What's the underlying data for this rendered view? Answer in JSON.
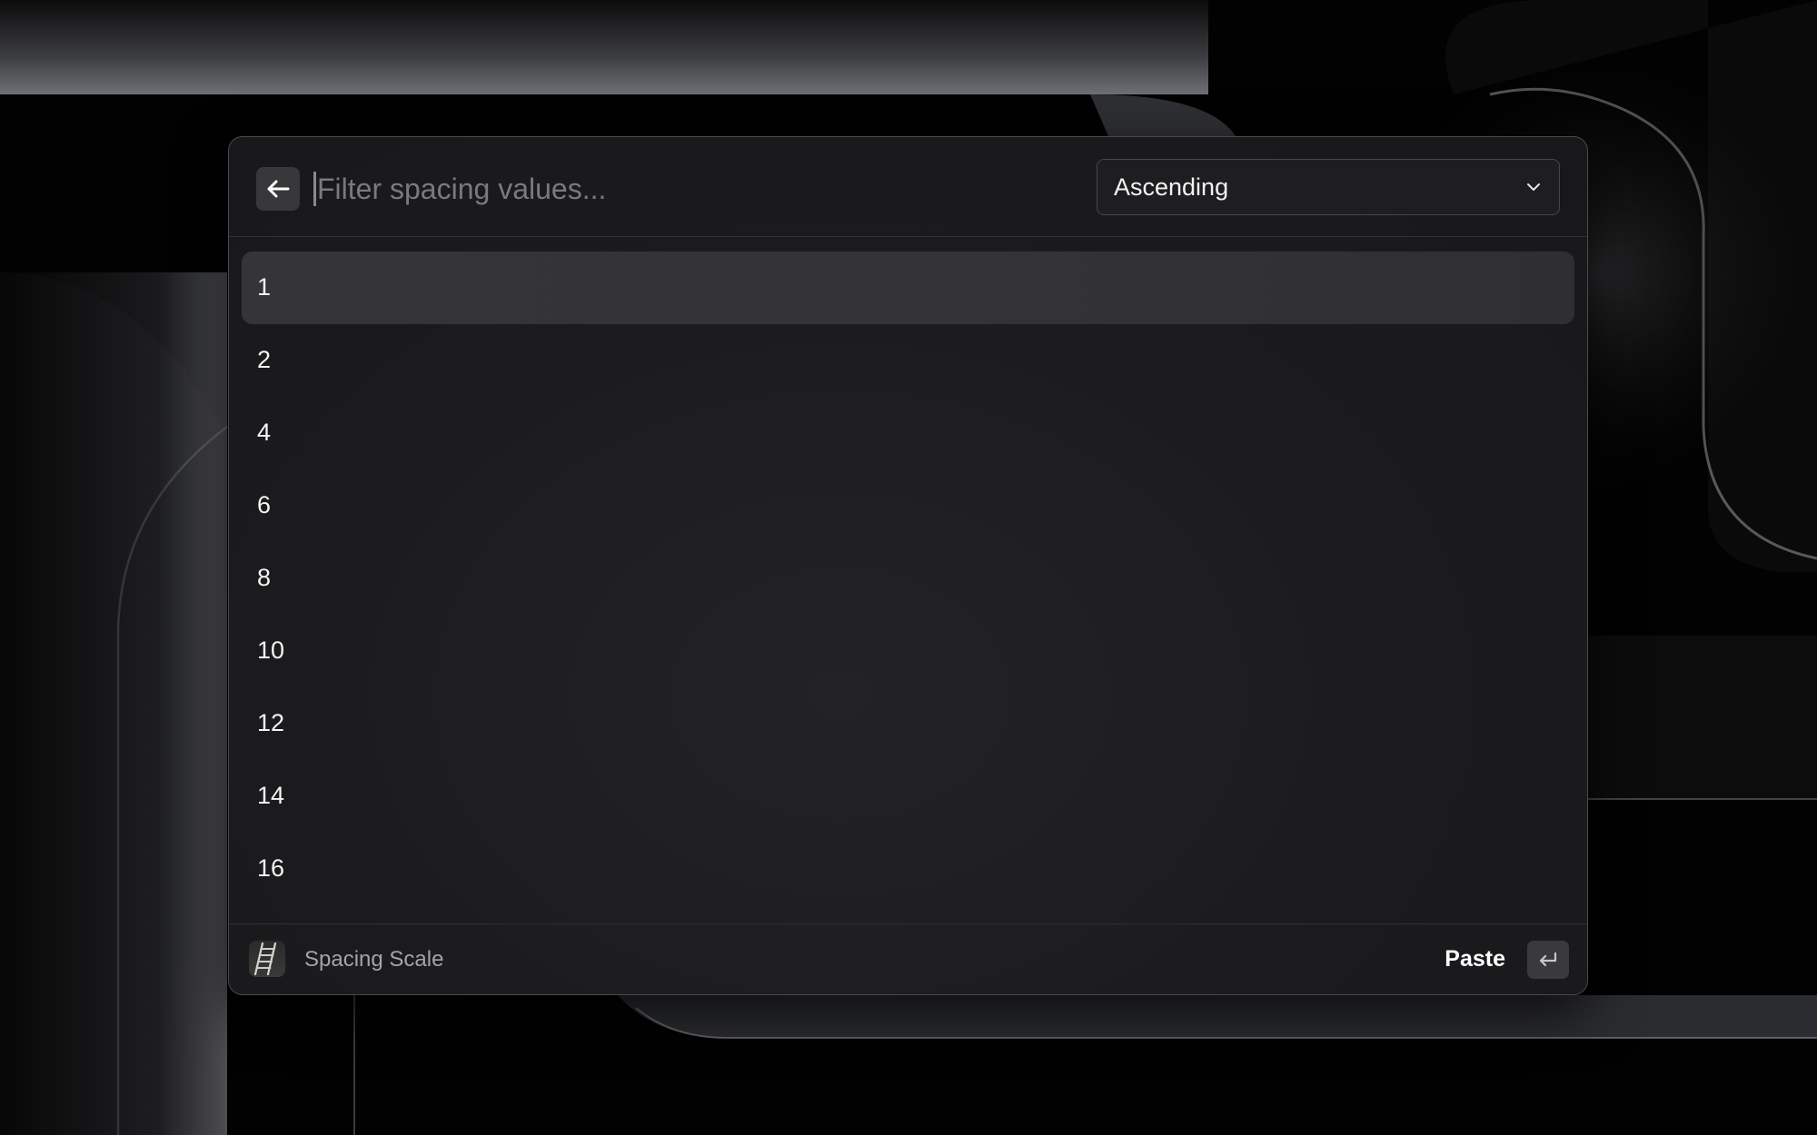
{
  "search": {
    "placeholder": "Filter spacing values...",
    "value": ""
  },
  "sort": {
    "selected": "Ascending"
  },
  "list": {
    "items": [
      {
        "label": "1",
        "selected": true
      },
      {
        "label": "2",
        "selected": false
      },
      {
        "label": "4",
        "selected": false
      },
      {
        "label": "6",
        "selected": false
      },
      {
        "label": "8",
        "selected": false
      },
      {
        "label": "10",
        "selected": false
      },
      {
        "label": "12",
        "selected": false
      },
      {
        "label": "14",
        "selected": false
      },
      {
        "label": "16",
        "selected": false
      }
    ]
  },
  "footer": {
    "extension_title": "Spacing Scale",
    "primary_action": "Paste",
    "extension_icon": "ladder-icon",
    "shortcut_icon": "enter-key-icon"
  },
  "icons": {
    "back": "arrow-left-icon",
    "dropdown": "chevron-down-icon"
  },
  "colors": {
    "window_background": "#1b1b1d",
    "selected_row": "#353537",
    "text_primary": "#f4f4f4",
    "text_secondary": "#a4a4a8",
    "border": "#4a4a4e"
  }
}
